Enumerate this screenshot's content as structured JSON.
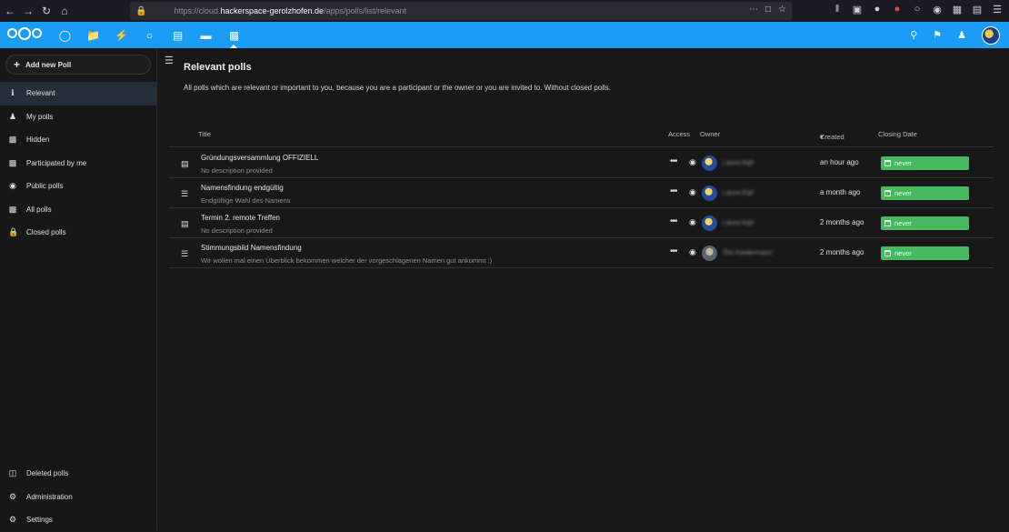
{
  "browser": {
    "url_prefix": "https://cloud.",
    "url_host": "hackerspace-gerolzhofen.de",
    "url_path": "/apps/polls/list/relevant"
  },
  "header": {
    "apps": [
      "dashboard-icon",
      "files-icon",
      "activity-icon",
      "talk-icon",
      "calendar-icon",
      "deck-icon",
      "polls-icon"
    ]
  },
  "sidebar": {
    "add_label": "Add new Poll",
    "items": [
      {
        "label": "Relevant",
        "icon": "info-icon"
      },
      {
        "label": "My polls",
        "icon": "user-icon"
      },
      {
        "label": "Hidden",
        "icon": "poll-icon"
      },
      {
        "label": "Participated by me",
        "icon": "poll-icon"
      },
      {
        "label": "Public polls",
        "icon": "globe-icon"
      },
      {
        "label": "All polls",
        "icon": "poll-icon"
      },
      {
        "label": "Closed polls",
        "icon": "lock-icon"
      }
    ],
    "bottom": [
      {
        "label": "Deleted polls",
        "icon": "trash-icon"
      },
      {
        "label": "Administration",
        "icon": "gear-icon"
      },
      {
        "label": "Settings",
        "icon": "gear-icon"
      }
    ]
  },
  "main": {
    "title": "Relevant polls",
    "description": "All polls which are relevant or important to you, because you are a participant or the owner or you are invited to. Without closed polls.",
    "columns": {
      "title": "Title",
      "access": "Access",
      "owner": "Owner",
      "created": "Created",
      "closing": "Closing Date"
    },
    "rows": [
      {
        "type_icon": "calendar-icon",
        "title": "Gründungsversammlung OFFIZIELL",
        "desc": "No description provided",
        "owner": "Laura Kipl",
        "created": "an hour ago",
        "closing": "never"
      },
      {
        "type_icon": "list-icon",
        "title": "Namensfindung endgültig",
        "desc": "Endgültige Wahl des Namens",
        "owner": "Laura Kipl",
        "created": "a month ago",
        "closing": "never"
      },
      {
        "type_icon": "calendar-icon",
        "title": "Termin 2. remote Treffen",
        "desc": "No description provided",
        "owner": "Laura Kipl",
        "created": "2 months ago",
        "closing": "never"
      },
      {
        "type_icon": "list-icon",
        "title": "Stimmungsbild Namensfindung",
        "desc": "Wir wollen mal einen Überblick bekommen welcher der vorgeschlagenen Namen gut ankommt :)",
        "owner": "Tim Kiedermann",
        "created": "2 months ago",
        "closing": "never"
      }
    ]
  },
  "colors": {
    "header": "#1b9cf7",
    "badge": "#46ba61",
    "background": "#181818"
  }
}
